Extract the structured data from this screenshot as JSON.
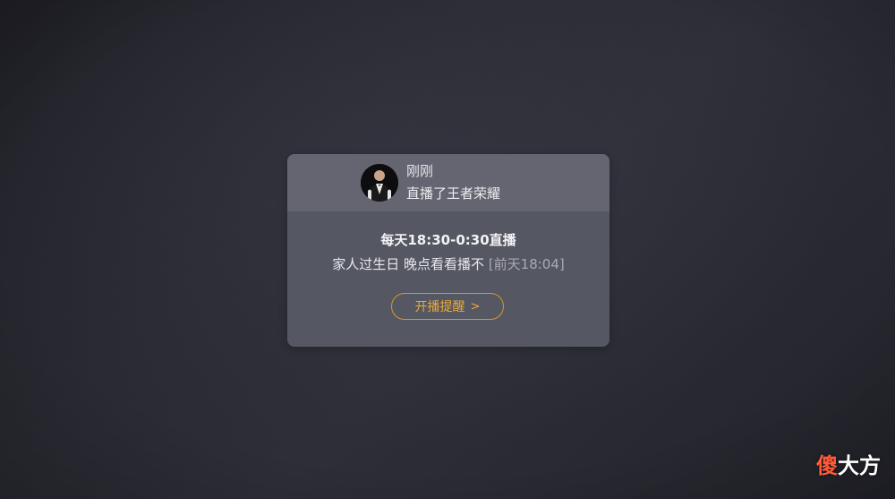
{
  "notification": {
    "streamer_name": "刚刚",
    "activity": "直播了王者荣耀",
    "schedule": "每天18:30-0:30直播",
    "message": "家人过生日 晚点看看播不",
    "timestamp": "[前天18:04]",
    "remind_button_label": "开播提醒",
    "remind_button_chevron": ">"
  },
  "watermark": {
    "first_char": "傻",
    "rest": "大方"
  },
  "colors": {
    "accent": "#e8a93a",
    "card_bg": "#555762",
    "header_bg": "#646571"
  },
  "icons": {
    "avatar": "avatar-portrait",
    "chevron": "chevron-right-icon"
  }
}
